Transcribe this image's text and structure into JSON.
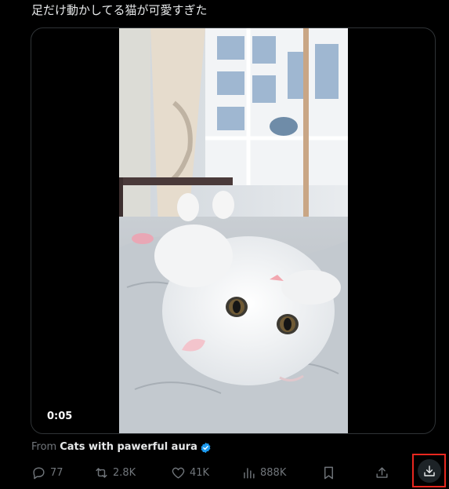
{
  "post": {
    "text": "足だけ動かしてる猫が可愛すぎた"
  },
  "media": {
    "timestamp": "0:05"
  },
  "source": {
    "prefix": "From",
    "author": "Cats with pawerful aura"
  },
  "actions": {
    "replies": "77",
    "reposts": "2.8K",
    "likes": "41K",
    "views": "888K"
  },
  "colors": {
    "background": "#000000",
    "text_primary": "#e7e9ea",
    "text_secondary": "#71767b",
    "verified_badge": "#1d9bf0",
    "highlight_box": "#e8271f"
  },
  "icons": [
    "reply-icon",
    "repost-icon",
    "like-icon",
    "views-icon",
    "bookmark-icon",
    "share-icon",
    "download-icon",
    "verified-badge-icon"
  ]
}
